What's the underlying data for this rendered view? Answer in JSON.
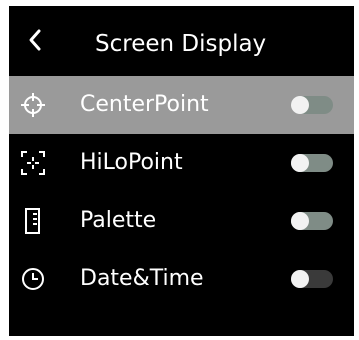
{
  "header": {
    "title": "Screen Display",
    "back_icon": "chevron-left-icon"
  },
  "items": [
    {
      "label": "CenterPoint",
      "icon": "crosshair-icon",
      "enabled": true,
      "selected": true
    },
    {
      "label": "HiLoPoint",
      "icon": "hilo-points-icon",
      "enabled": true,
      "selected": false
    },
    {
      "label": "Palette",
      "icon": "palette-bar-icon",
      "enabled": true,
      "selected": false
    },
    {
      "label": "Date&Time",
      "icon": "clock-icon",
      "enabled": false,
      "selected": false
    }
  ],
  "colors": {
    "background": "#000000",
    "selected_row": "#9a9a9a",
    "toggle_on": "#7f8c86",
    "toggle_off": "#3a3a3a",
    "text": "#ffffff"
  }
}
